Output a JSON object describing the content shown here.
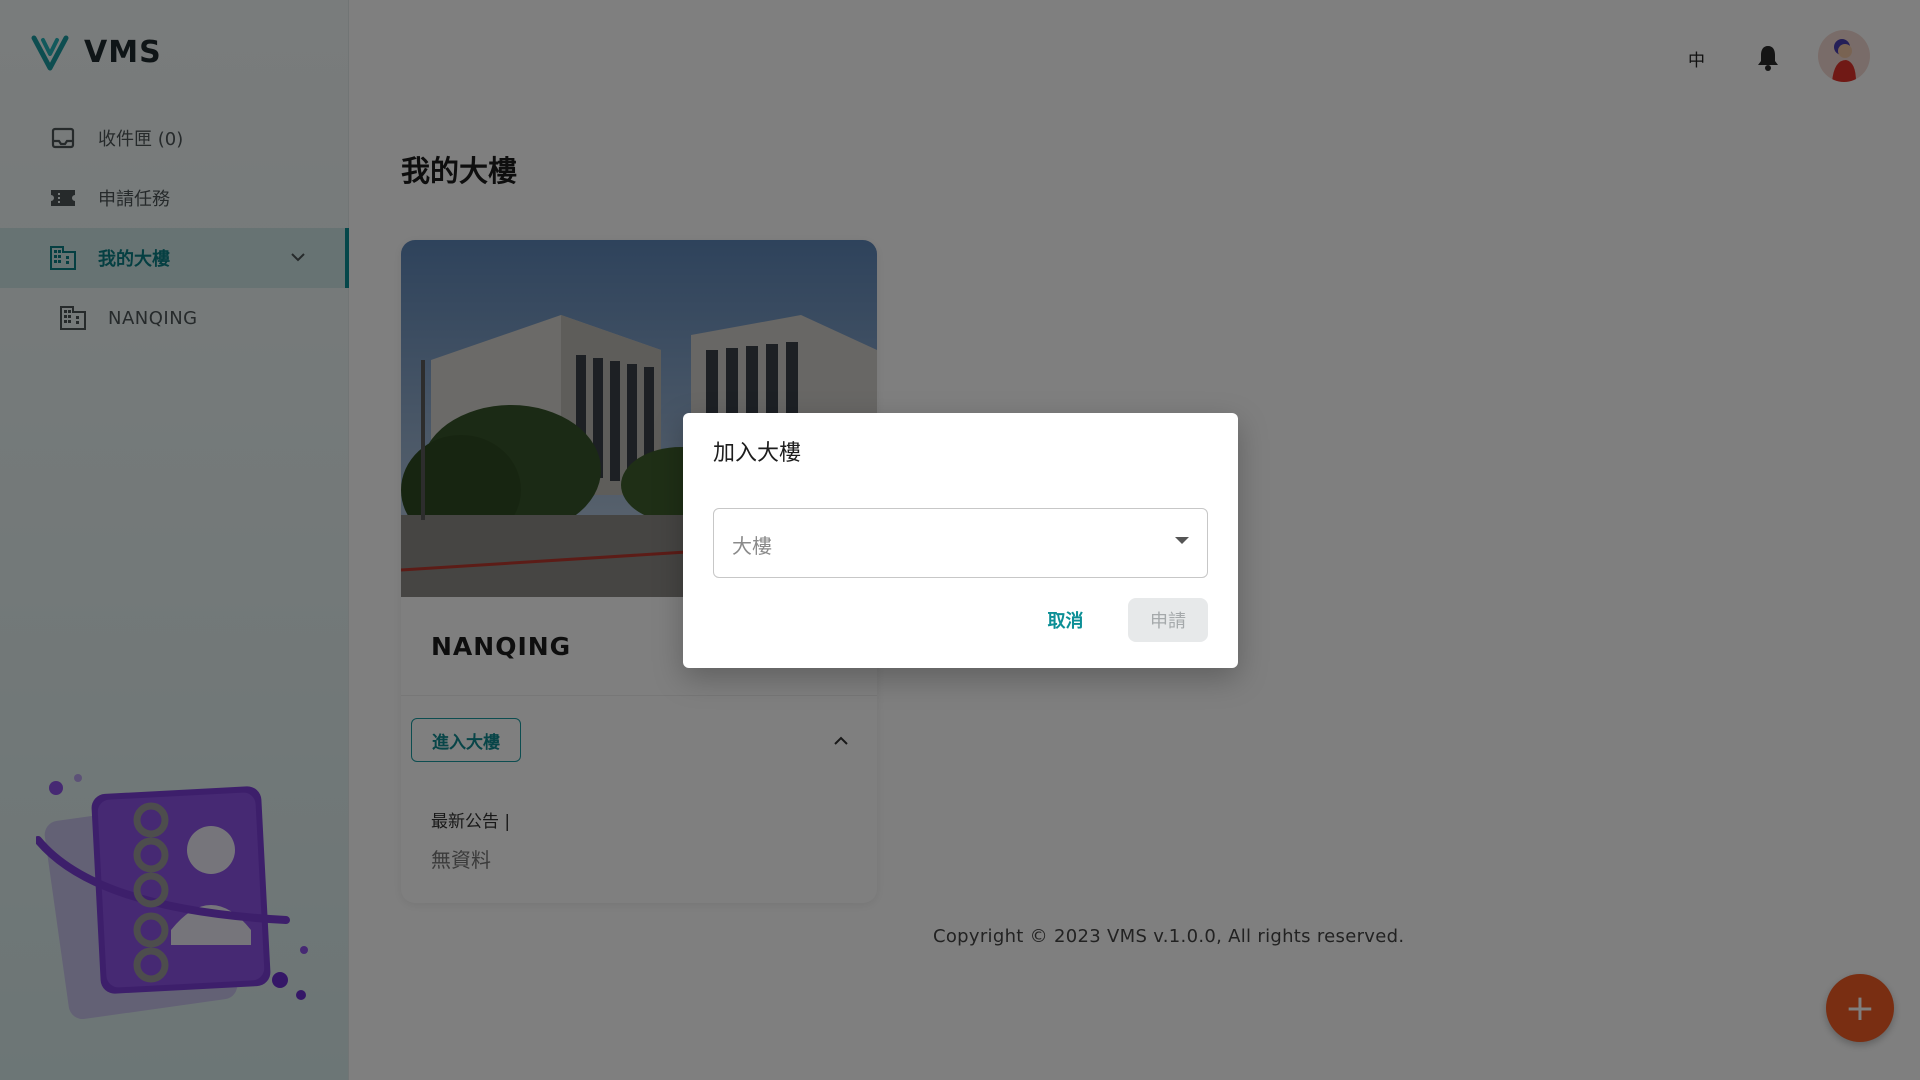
{
  "app": {
    "name": "VMS"
  },
  "sidebar": {
    "items": [
      {
        "label": "收件匣 (0)",
        "icon": "inbox-icon"
      },
      {
        "label": "申請任務",
        "icon": "ticket-icon"
      },
      {
        "label": "我的大樓",
        "icon": "building-icon",
        "active": true,
        "expanded": true
      }
    ],
    "sub_items": [
      {
        "label": "NANQING",
        "icon": "building-icon"
      }
    ]
  },
  "header": {
    "language": "中"
  },
  "page": {
    "title": "我的大樓"
  },
  "card": {
    "name": "NANQING",
    "enter_label": "進入大樓",
    "news_label": "最新公告 |",
    "news_empty": "無資料"
  },
  "footer": {
    "copyright": "Copyright © 2023 VMS v.1.0.0, All rights reserved."
  },
  "fab": {
    "label": "+"
  },
  "dialog": {
    "title": "加入大樓",
    "select_placeholder": "大樓",
    "cancel_label": "取消",
    "apply_label": "申請"
  },
  "colors": {
    "accent": "#0b8f95",
    "fab": "#f25c25"
  }
}
